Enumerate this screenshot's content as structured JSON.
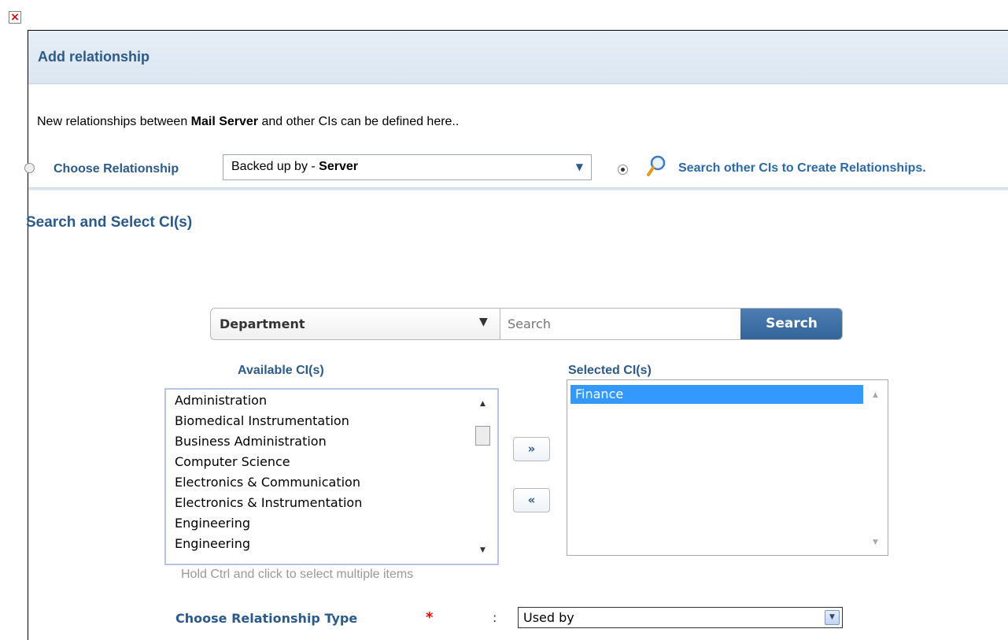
{
  "dialog": {
    "close_symbol": "×",
    "title": "Add relationship"
  },
  "intro": {
    "prefix": "New relationships between ",
    "ci_name": "Mail Server",
    "suffix": " and other CIs can be defined here.."
  },
  "relationship_mode": {
    "choose_label": "Choose Relationship",
    "relationship_value_prefix": "Backed up by - ",
    "relationship_value_bold": "Server",
    "search_link": "Search other CIs to Create Relationships.",
    "selected_mode": "search"
  },
  "section_title": "Search and Select CI(s)",
  "search": {
    "filter_value": "Department",
    "placeholder": "Search",
    "button_label": "Search"
  },
  "available": {
    "title": "Available CI(s)",
    "items": [
      "Administration",
      "Biomedical Instrumentation",
      "Business Administration",
      "Computer Science",
      "Electronics & Communication",
      "Electronics & Instrumentation",
      "Engineering",
      "Engineering"
    ]
  },
  "selected": {
    "title": "Selected CI(s)",
    "items": [
      "Finance"
    ]
  },
  "move": {
    "add_symbol": "»",
    "remove_symbol": "«"
  },
  "hint": "Hold Ctrl and click to select multiple items",
  "relationship_type": {
    "label": "Choose Relationship Type",
    "required_mark": "*",
    "colon": ":",
    "value": "Used by"
  },
  "colors": {
    "accent": "#2c5a8a",
    "link": "#2c6aa8",
    "search_button": "#3d6ea6",
    "selection": "#3399ff",
    "required": "#ee0000"
  }
}
